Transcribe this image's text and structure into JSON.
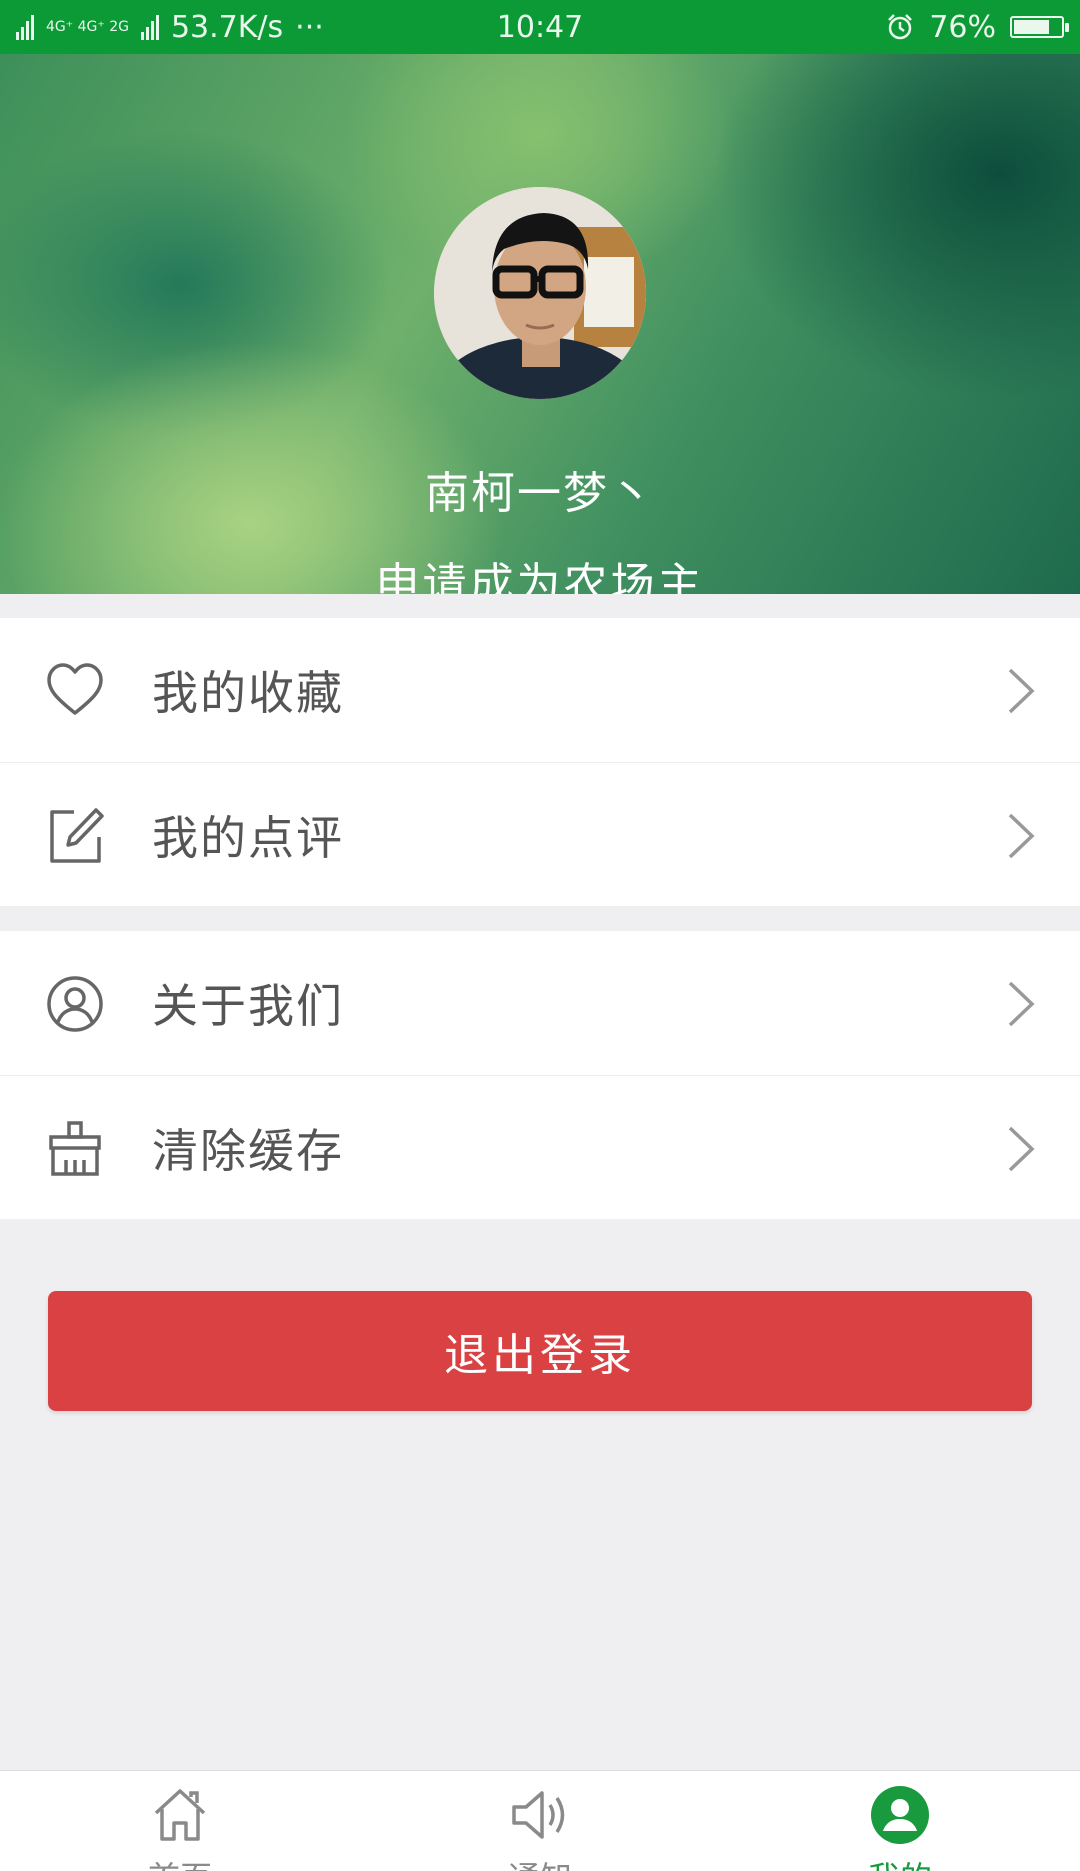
{
  "status_bar": {
    "signal1_label": "2G",
    "signal2_label": "4G⁺ 4G⁺ 2G",
    "speed": "53.7K/s",
    "more": "···",
    "time": "10:47",
    "battery_pct": "76%",
    "battery_level": 0.76,
    "alarm_icon": "alarm-clock-icon"
  },
  "profile": {
    "username": "南柯一梦丶",
    "apply_label": "申请成为农场主"
  },
  "menu": {
    "group1": [
      {
        "label": "我的收藏",
        "icon": "heart-icon"
      },
      {
        "label": "我的点评",
        "icon": "edit-icon"
      }
    ],
    "group2": [
      {
        "label": "关于我们",
        "icon": "user-circle-icon"
      },
      {
        "label": "清除缓存",
        "icon": "broom-icon"
      }
    ]
  },
  "logout_label": "退出登录",
  "tabs": [
    {
      "label": "首页",
      "icon": "home-icon",
      "active": false
    },
    {
      "label": "通知",
      "icon": "speaker-icon",
      "active": false
    },
    {
      "label": "我的",
      "icon": "profile-icon",
      "active": true
    }
  ],
  "colors": {
    "status_bar": "#0c9a36",
    "accent": "#1a9a3e",
    "logout": "#d94143"
  }
}
